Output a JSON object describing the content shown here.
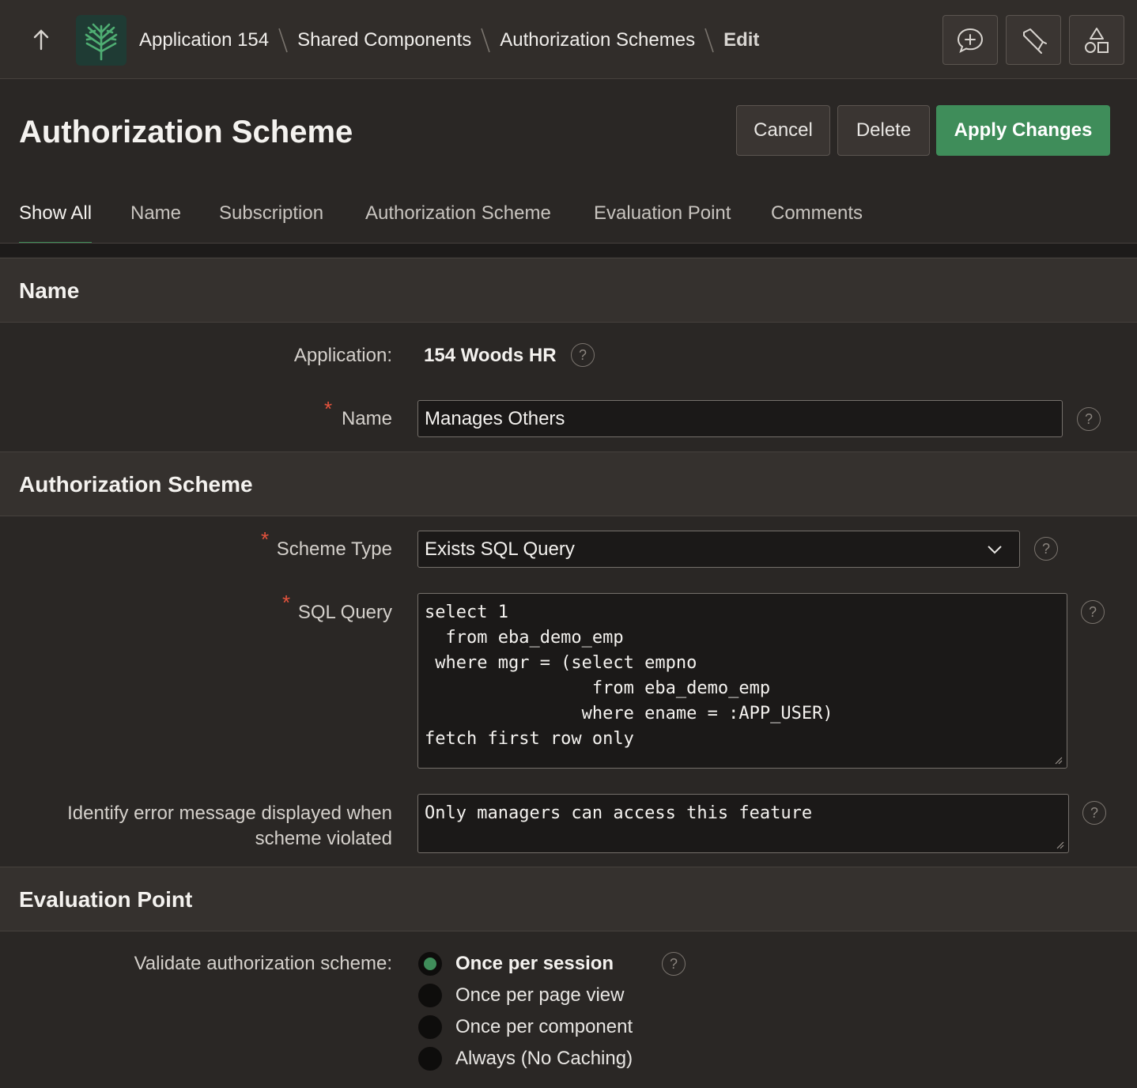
{
  "breadcrumb": {
    "items": [
      "Application 154",
      "Shared Components",
      "Authorization Schemes"
    ],
    "current": "Edit"
  },
  "page": {
    "title": "Authorization Scheme",
    "buttons": {
      "cancel": "Cancel",
      "delete": "Delete",
      "apply": "Apply Changes"
    }
  },
  "tabs": [
    "Show All",
    "Name",
    "Subscription",
    "Authorization Scheme",
    "Evaluation Point",
    "Comments"
  ],
  "sections": {
    "name": {
      "title": "Name",
      "application_label": "Application:",
      "application_value": "154 Woods HR",
      "name_label": "Name",
      "name_value": "Manages Others"
    },
    "auth": {
      "title": "Authorization Scheme",
      "scheme_type_label": "Scheme Type",
      "scheme_type_value": "Exists SQL Query",
      "sql_label": "SQL Query",
      "sql_value": "select 1\n  from eba_demo_emp\n where mgr = (select empno\n                from eba_demo_emp\n               where ename = :APP_USER)\nfetch first row only",
      "error_label": "Identify error message displayed when scheme violated",
      "error_value": "Only managers can access this feature"
    },
    "eval": {
      "title": "Evaluation Point",
      "label": "Validate authorization scheme:",
      "options": [
        "Once per session",
        "Once per page view",
        "Once per component",
        "Always (No Caching)"
      ],
      "selected": "Once per session"
    }
  },
  "required_mark": "*",
  "help_glyph": "?",
  "colors": {
    "accent": "#3f8d5a",
    "required": "#e5533d",
    "background": "#2a2725"
  },
  "icons": [
    "arrow-up-icon",
    "app-logo-icon",
    "add-comment-icon",
    "highlighter-icon",
    "shapes-icon",
    "chevron-down-icon",
    "help-icon"
  ]
}
